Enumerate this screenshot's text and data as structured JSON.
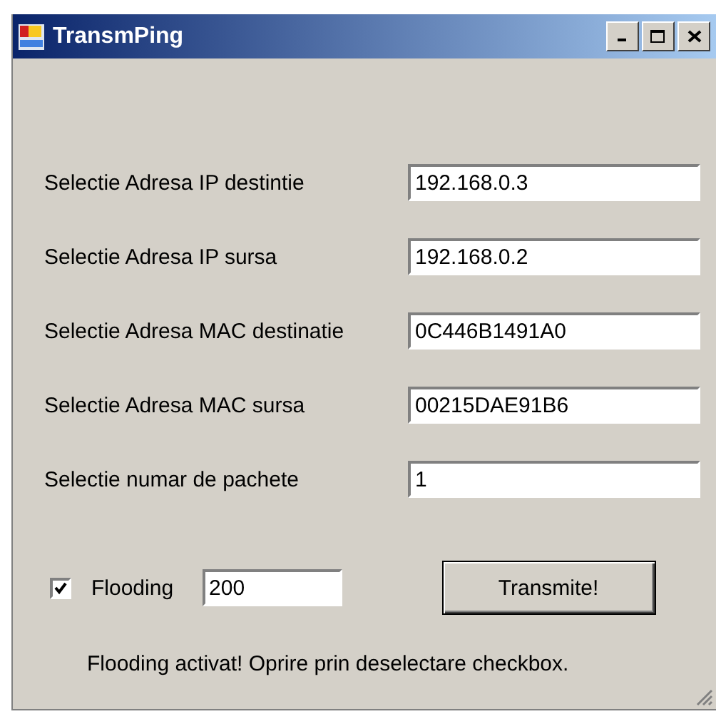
{
  "window": {
    "title": "TransmPing"
  },
  "fields": [
    {
      "label": "Selectie Adresa IP destintie",
      "value": "192.168.0.3"
    },
    {
      "label": "Selectie Adresa IP sursa",
      "value": "192.168.0.2"
    },
    {
      "label": "Selectie Adresa MAC destinatie",
      "value": "0C446B1491A0"
    },
    {
      "label": "Selectie Adresa MAC sursa",
      "value": "00215DAE91B6"
    },
    {
      "label": "Selectie numar de pachete",
      "value": "1"
    }
  ],
  "flooding": {
    "label": "Flooding",
    "checked": true,
    "value": "200"
  },
  "transmit_button": "Transmite!",
  "status": "Flooding activat! Oprire prin deselectare checkbox."
}
